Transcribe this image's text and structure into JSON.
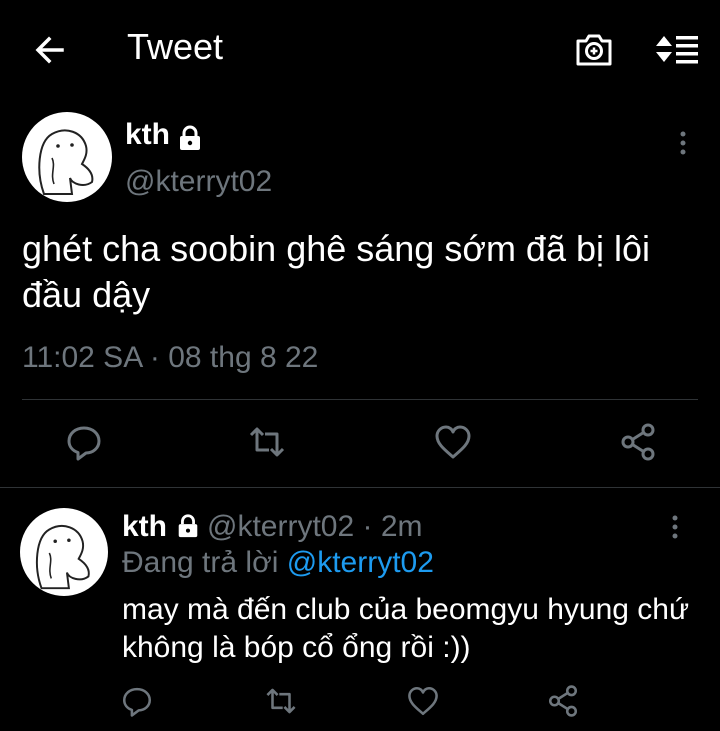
{
  "header": {
    "title": "Tweet",
    "back_icon": "arrow-left-icon",
    "camera_icon": "camera-plus-icon",
    "sort_icon": "sort-icon"
  },
  "tweet": {
    "author_name": "kth",
    "author_handle": "@kterryt02",
    "text": "ghét cha soobin ghê sáng sớm đã bị lôi đầu dậy",
    "time": "11:02 SA",
    "separator": " · ",
    "date": "08 thg 8 22",
    "actions": [
      "reply-icon",
      "retweet-icon",
      "like-icon",
      "share-icon"
    ]
  },
  "reply": {
    "author_name": "kth",
    "author_handle": "@kterryt02",
    "separator": " · ",
    "age": "2m",
    "replying_label": "Đang trả lời ",
    "replying_to": "@kterryt02",
    "text": "may mà đến club của beomgyu hyung chứ không là bóp cổ ổng rồi :))",
    "actions": [
      "reply-icon",
      "retweet-icon",
      "like-icon",
      "share-icon"
    ]
  },
  "colors": {
    "background": "#000000",
    "text": "#ffffff",
    "muted": "#6e767d",
    "accent": "#1d9bf0",
    "divider": "#2f3336"
  }
}
